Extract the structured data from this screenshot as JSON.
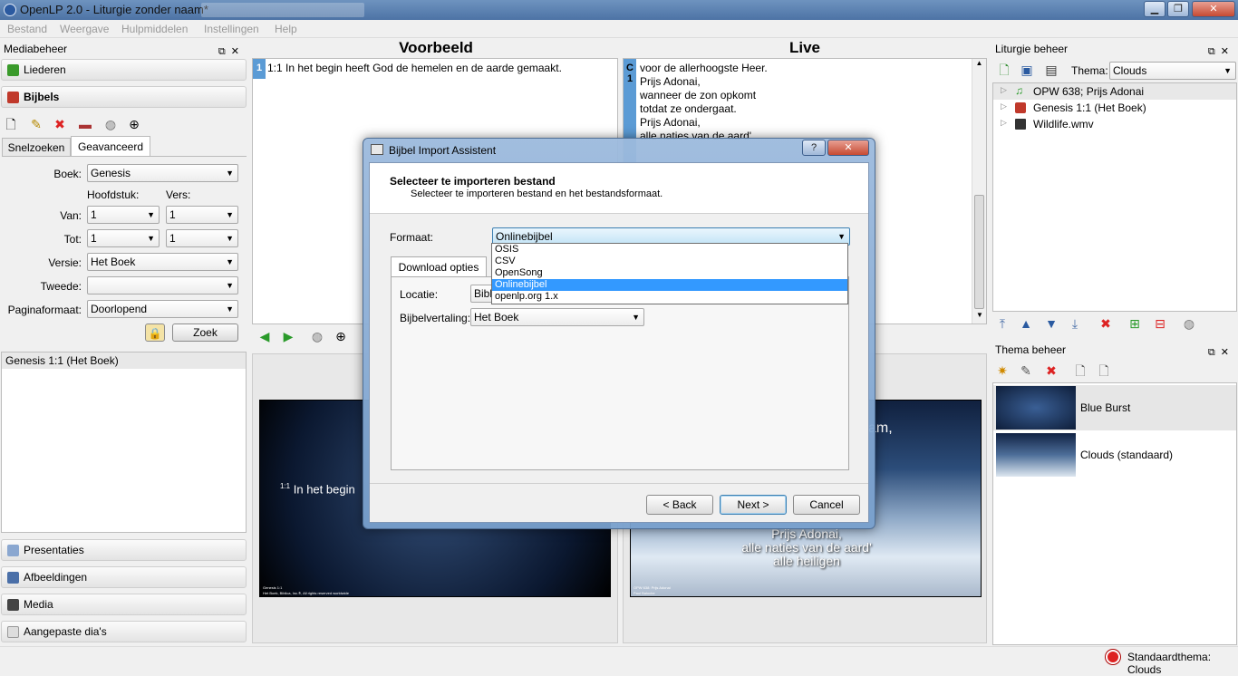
{
  "window": {
    "title": "OpenLP 2.0 - Liturgie zonder naam*",
    "min": "▁",
    "max": "❐",
    "close": "✕"
  },
  "menu": [
    "Bestand",
    "Weergave",
    "Hulpmiddelen",
    "Instellingen",
    "Help"
  ],
  "media": {
    "header": "Mediabeheer",
    "liederen": "Liederen",
    "bijbels": "Bijbels",
    "tabs": [
      "Snelzoeken",
      "Geavanceerd"
    ],
    "labels": {
      "boek": "Boek:",
      "hoofdstuk": "Hoofdstuk:",
      "vers": "Vers:",
      "van": "Van:",
      "tot": "Tot:",
      "versie": "Versie:",
      "tweede": "Tweede:",
      "paginaformaat": "Paginaformaat:"
    },
    "values": {
      "boek": "Genesis",
      "van_h": "1",
      "van_v": "1",
      "tot_h": "1",
      "tot_v": "1",
      "versie": "Het Boek",
      "tweede": "",
      "paginaformaat": "Doorlopend"
    },
    "zoek": "Zoek",
    "result": "Genesis 1:1 (Het Boek)",
    "bottom": [
      "Presentaties",
      "Afbeeldingen",
      "Media",
      "Aangepaste dia's"
    ]
  },
  "preview": {
    "title": "Voorbeeld",
    "row_num": "1",
    "row_text": "1:1 In het begin heeft God de hemelen en de aarde gemaakt.",
    "slide_text": "In het begin",
    "slide_sup": "1:1",
    "slide_footer1": "Genesis 1:1",
    "slide_footer2": "Het Boek, Biblica, Inc.®, All rights reserved worldwide"
  },
  "live": {
    "title": "Live",
    "tags": [
      "C",
      "1"
    ],
    "lines": [
      "voor de allerhoogste Heer.",
      "Prijs Adonai,",
      "wanneer de zon opkomt",
      "totdat ze ondergaat.",
      "Prijs Adonai,",
      "alle naties van de aard'"
    ],
    "slide_lines": [
      "Prijs Adonai,",
      "alle naties van de aard'",
      "alle heiligen"
    ],
    "slide_frag1": "am,",
    "slide_footer1": "OPW 638: Prijs Adonai",
    "slide_footer2": "Paul Baloche"
  },
  "liturgie": {
    "header": "Liturgie beheer",
    "thema_label": "Thema:",
    "thema": "Clouds",
    "items": [
      "OPW 638; Prijs Adonai",
      "Genesis 1:1 (Het Boek)",
      "Wildlife.wmv"
    ]
  },
  "themes": {
    "header": "Thema beheer",
    "items": [
      "Blue Burst",
      "Clouds (standaard)"
    ]
  },
  "status": {
    "text": "Standaardthema: Clouds"
  },
  "dialog": {
    "title": "Bijbel Import Assistent",
    "help": "?",
    "close": "✕",
    "heading": "Selecteer te importeren bestand",
    "subheading": "Selecteer te importeren bestand en het bestandsformaat.",
    "formaat_label": "Formaat:",
    "formaat": "Onlinebijbel",
    "options": [
      "OSIS",
      "CSV",
      "OpenSong",
      "Onlinebijbel",
      "openlp.org 1.x"
    ],
    "tab": "Download opties",
    "locatie_label": "Locatie:",
    "locatie": "Bible",
    "vertaling_label": "Bijbelvertaling:",
    "vertaling": "Het Boek",
    "back": "< Back",
    "next": "Next >",
    "cancel": "Cancel"
  },
  "colors": {
    "accent": "#3399ff",
    "titlebar": "#5a7fb0"
  }
}
